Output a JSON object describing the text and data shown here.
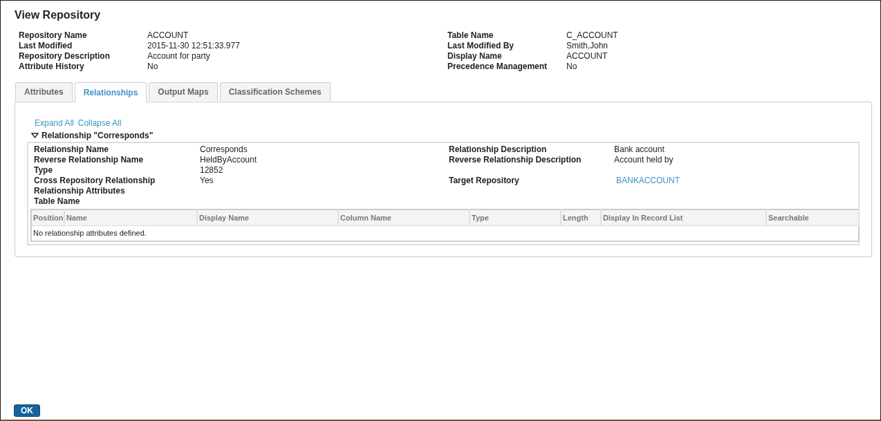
{
  "title": "View Repository",
  "info": [
    {
      "label": "Repository Name",
      "value": "ACCOUNT",
      "label2": "Table Name",
      "value2": "C_ACCOUNT"
    },
    {
      "label": "Last Modified",
      "value": "2015-11-30 12:51:33.977",
      "label2": "Last Modified By",
      "value2": "Smith,John"
    },
    {
      "label": "Repository Description",
      "value": "Account for party",
      "label2": "Display Name",
      "value2": "ACCOUNT"
    },
    {
      "label": "Attribute History",
      "value": "No",
      "label2": "Precedence Management",
      "value2": "No"
    }
  ],
  "tabs": [
    {
      "label": "Attributes",
      "selected": false
    },
    {
      "label": "Relationships",
      "selected": true
    },
    {
      "label": "Output Maps",
      "selected": false
    },
    {
      "label": "Classification Schemes",
      "selected": false
    }
  ],
  "links": [
    "Expand All",
    "Collapse All"
  ],
  "relationship": {
    "title": "Relationship \"Corresponds\"",
    "expanded": true,
    "rows": [
      {
        "cells": [
          {
            "label": "Relationship Name",
            "value": "Corresponds"
          },
          {
            "label": "Relationship Description",
            "value": "Bank account"
          }
        ]
      },
      {
        "cells": [
          {
            "label": "Reverse Relationship Name",
            "value": "HeldByAccount"
          },
          {
            "label": "Reverse Relationship Description",
            "value": "Account held by"
          }
        ]
      },
      {
        "cells": [
          {
            "label": "Type",
            "value": "12852"
          }
        ]
      },
      {
        "cells": [
          {
            "label": "Cross Repository Relationship",
            "value": "Yes"
          },
          {
            "label": "Target Repository",
            "value": "BANKACCOUNT",
            "kind": "link"
          }
        ]
      },
      {
        "cells": [
          {
            "label": "Relationship Attributes"
          }
        ]
      },
      {
        "cells": [
          {
            "label": "Table Name"
          }
        ]
      }
    ],
    "table": {
      "columns": [
        "Position",
        "Name",
        "Display Name",
        "Column Name",
        "Type",
        "Length",
        "Display In Record List",
        "Searchable"
      ],
      "empty_message": "No relationship attributes defined."
    }
  },
  "buttons": [
    "OK"
  ]
}
